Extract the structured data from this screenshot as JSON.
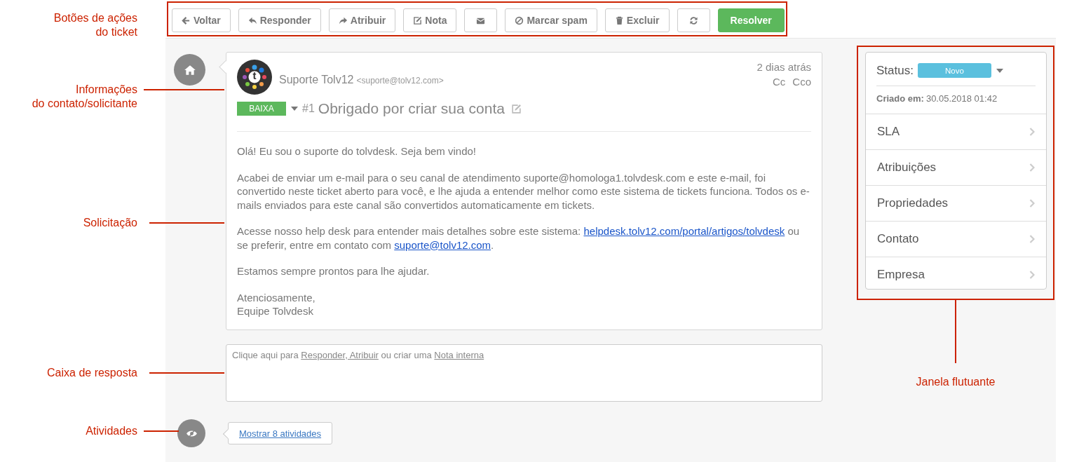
{
  "annotations": [
    {
      "text": "Botões de ações\ndo ticket"
    },
    {
      "text": "Informações\ndo contato/solicitante"
    },
    {
      "text": "Solicitação"
    },
    {
      "text": "Caixa de resposta"
    },
    {
      "text": "Atividades"
    },
    {
      "text": "Janela flutuante"
    }
  ],
  "toolbar": [
    {
      "label": "Voltar",
      "kind": "default"
    },
    {
      "label": "Responder",
      "kind": "default"
    },
    {
      "label": "Atribuir",
      "kind": "default"
    },
    {
      "label": "Nota",
      "kind": "default"
    },
    {
      "kind": "icon"
    },
    {
      "label": "Marcar spam",
      "kind": "default"
    },
    {
      "label": "Excluir",
      "kind": "default"
    },
    {
      "kind": "icon"
    },
    {
      "label": "Resolver",
      "kind": "primary"
    }
  ],
  "ticket": {
    "avatar_letter": "t",
    "sender": "Suporte Tolv12",
    "email": "<suporte@tolv12.com>",
    "time": "2 dias atrás",
    "cc": "Cc",
    "bcc": "Cco",
    "priority": {
      "label": "BAIXA",
      "color": "#5cb85c"
    },
    "number": "#1",
    "subject": "Obrigado por criar sua conta",
    "body": [
      {
        "parts": [
          {
            "text": "Olá! Eu sou o suporte do tolvdesk. Seja bem vindo!"
          }
        ]
      },
      {
        "parts": [
          {
            "text": "Acabei de enviar um e-mail para o seu canal de atendimento suporte@homologa1.tolvdesk.com e este e-mail, foi convertido neste ticket aberto para você, e lhe ajuda a entender melhor como este sistema de tickets funciona. Todos os e-mails enviados para este canal são convertidos automaticamente em tickets."
          }
        ]
      },
      {
        "parts": [
          {
            "text": "Acesse nosso help desk para entender mais detalhes sobre este sistema: "
          },
          {
            "link": "helpdesk.tolv12.com/portal/artigos/tolvdesk"
          },
          {
            "text": " ou se preferir, entre em contato com "
          },
          {
            "link": "suporte@tolv12.com"
          },
          {
            "text": "."
          }
        ]
      },
      {
        "parts": [
          {
            "text": "Estamos sempre prontos para lhe ajudar."
          }
        ]
      },
      {
        "parts": [
          {
            "text": "Atenciosamente,\nEquipe Tolvdesk"
          }
        ]
      }
    ]
  },
  "reply_box": {
    "parts": [
      {
        "text": "Clique aqui para "
      },
      {
        "link": "Responder, Atribuir"
      },
      {
        "text": " ou criar uma "
      },
      {
        "link": "Nota interna"
      }
    ]
  },
  "activities": {
    "link": "Mostrar 8 atividades"
  },
  "panel": {
    "status_label": "Status:",
    "status": {
      "label": "Novo",
      "color": "#5bc0de"
    },
    "created_label": "Criado em:",
    "created": "30.05.2018 01:42",
    "items": [
      "SLA",
      "Atribuições",
      "Propriedades",
      "Contato",
      "Empresa"
    ]
  }
}
